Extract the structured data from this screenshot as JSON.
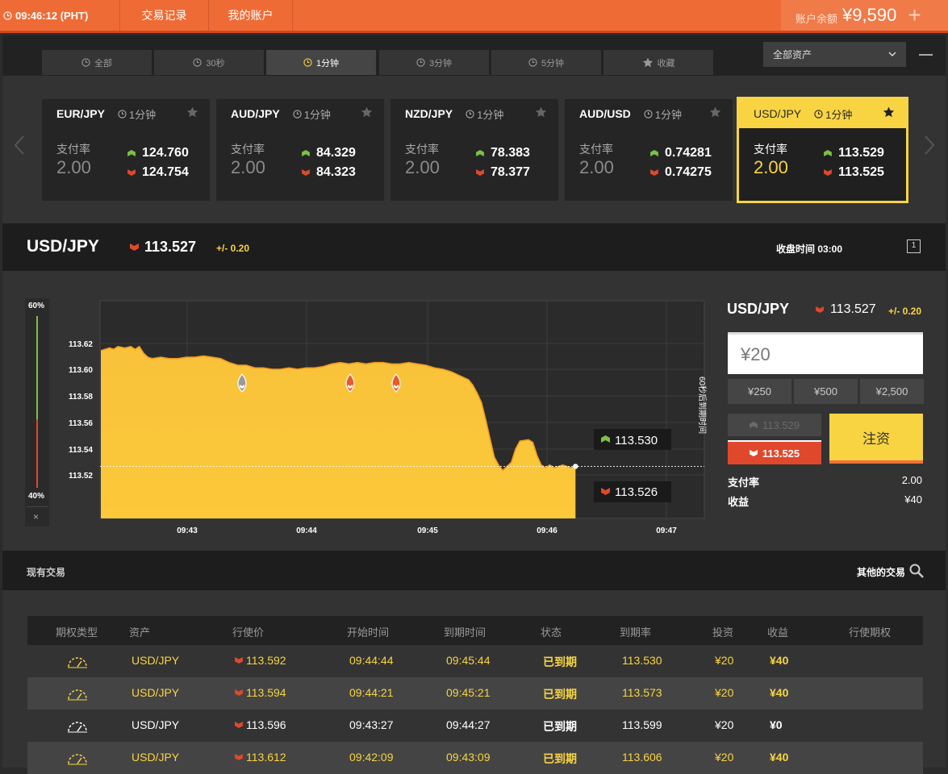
{
  "topbar": {
    "clock": "09:46:12 (PHT)",
    "nav_history": "交易记录",
    "nav_account": "我的账户",
    "balance_label": "账户余额",
    "balance_value": "¥9,590"
  },
  "filters": {
    "tabs": [
      {
        "label": "全部",
        "icon": "clock-icon"
      },
      {
        "label": "30秒",
        "icon": "clock-icon"
      },
      {
        "label": "1分钟",
        "icon": "clock-icon",
        "active": true
      },
      {
        "label": "3分钟",
        "icon": "clock-icon"
      },
      {
        "label": "5分钟",
        "icon": "clock-icon"
      },
      {
        "label": "收藏",
        "icon": "star-icon"
      }
    ],
    "asset_select": "全部资产"
  },
  "cards": [
    {
      "pair": "EUR/JPY",
      "timeframe": "1分钟",
      "rate_label": "支付率",
      "rate": "2.00",
      "up": "124.760",
      "down": "124.754"
    },
    {
      "pair": "AUD/JPY",
      "timeframe": "1分钟",
      "rate_label": "支付率",
      "rate": "2.00",
      "up": "84.329",
      "down": "84.323"
    },
    {
      "pair": "NZD/JPY",
      "timeframe": "1分钟",
      "rate_label": "支付率",
      "rate": "2.00",
      "up": "78.383",
      "down": "78.377"
    },
    {
      "pair": "AUD/USD",
      "timeframe": "1分钟",
      "rate_label": "支付率",
      "rate": "2.00",
      "up": "0.74281",
      "down": "0.74275"
    },
    {
      "pair": "USD/JPY",
      "timeframe": "1分钟",
      "rate_label": "支付率",
      "rate": "2.00",
      "up": "113.529",
      "down": "113.525",
      "selected": true
    }
  ],
  "pair_header": {
    "pair": "USD/JPY",
    "price": "113.527",
    "change": "+/- 0.20",
    "close_label": "收盘时间 03:00"
  },
  "sentiment": {
    "top": "60%",
    "bottom": "40%",
    "close": "×"
  },
  "chart_data": {
    "type": "area",
    "y_ticks": [
      "113.62",
      "113.60",
      "113.58",
      "113.56",
      "113.54",
      "113.52"
    ],
    "x_ticks": [
      "09:43",
      "09:44",
      "09:45",
      "09:46",
      "09:47"
    ],
    "expiry_text": "60秒后到期时间",
    "current_line": 113.527,
    "up_label": "113.530",
    "down_label": "113.526",
    "series": [
      {
        "points": [
          [
            0,
            113.614
          ],
          [
            0.05,
            113.615
          ],
          [
            0.1,
            113.616
          ],
          [
            0.15,
            113.615
          ],
          [
            0.2,
            113.617
          ],
          [
            0.28,
            113.616
          ],
          [
            0.35,
            113.617
          ],
          [
            0.4,
            113.615
          ],
          [
            0.45,
            113.617
          ],
          [
            0.5,
            113.612
          ],
          [
            0.55,
            113.609
          ],
          [
            0.6,
            113.608
          ],
          [
            0.7,
            113.609
          ],
          [
            0.8,
            113.608
          ],
          [
            0.9,
            113.608
          ],
          [
            1.0,
            113.609
          ],
          [
            1.1,
            113.609
          ],
          [
            1.2,
            113.61
          ],
          [
            1.3,
            113.609
          ],
          [
            1.4,
            113.608
          ],
          [
            1.5,
            113.605
          ],
          [
            1.6,
            113.603
          ],
          [
            1.7,
            113.603
          ],
          [
            1.8,
            113.601
          ],
          [
            1.9,
            113.601
          ],
          [
            2.0,
            113.6
          ],
          [
            2.1,
            113.6
          ],
          [
            2.2,
            113.601
          ],
          [
            2.3,
            113.6
          ],
          [
            2.4,
            113.601
          ],
          [
            2.5,
            113.601
          ],
          [
            2.6,
            113.602
          ],
          [
            2.7,
            113.604
          ],
          [
            2.8,
            113.605
          ],
          [
            2.9,
            113.604
          ],
          [
            3.0,
            113.605
          ],
          [
            3.1,
            113.604
          ],
          [
            3.2,
            113.605
          ],
          [
            3.3,
            113.605
          ],
          [
            3.4,
            113.604
          ],
          [
            3.5,
            113.604
          ],
          [
            3.6,
            113.605
          ],
          [
            3.7,
            113.604
          ],
          [
            3.8,
            113.603
          ],
          [
            3.9,
            113.601
          ],
          [
            4.0,
            113.6
          ],
          [
            4.1,
            113.598
          ],
          [
            4.2,
            113.595
          ],
          [
            4.3,
            113.592
          ],
          [
            4.35,
            113.588
          ],
          [
            4.4,
            113.582
          ],
          [
            4.45,
            113.575
          ],
          [
            4.5,
            113.562
          ],
          [
            4.55,
            113.548
          ],
          [
            4.6,
            113.534
          ],
          [
            4.65,
            113.528
          ],
          [
            4.7,
            113.524
          ],
          [
            4.8,
            113.53
          ],
          [
            4.85,
            113.54
          ],
          [
            4.9,
            113.546
          ],
          [
            5.0,
            113.547
          ],
          [
            5.05,
            113.545
          ],
          [
            5.1,
            113.535
          ],
          [
            5.15,
            113.528
          ],
          [
            5.2,
            113.526
          ],
          [
            5.25,
            113.528
          ],
          [
            5.3,
            113.526
          ],
          [
            5.4,
            113.528
          ],
          [
            5.5,
            113.526
          ],
          [
            5.55,
            113.527
          ]
        ]
      }
    ]
  },
  "order_panel": {
    "pair": "USD/JPY",
    "price": "113.527",
    "change": "+/- 0.20",
    "amount": "¥20",
    "quick_amounts": [
      "¥250",
      "¥500",
      "¥2,500"
    ],
    "up_price": "113.529",
    "down_price": "113.525",
    "invest_button": "注资",
    "payout_label": "支付率",
    "payout_value": "2.00",
    "profit_label": "收益",
    "profit_value": "¥40"
  },
  "trades_bar": {
    "title": "现有交易",
    "other_label": "其他的交易"
  },
  "table": {
    "headers": [
      "期权类型",
      "资产",
      "行使价",
      "开始时间",
      "到期时间",
      "状态",
      "到期率",
      "投资",
      "收益",
      "行使期权"
    ],
    "rows": [
      {
        "asset": "USD/JPY",
        "strike": "113.592",
        "start": "09:44:44",
        "expiry": "09:45:44",
        "status": "已到期",
        "rate": "113.530",
        "invest": "¥20",
        "profit": "¥40",
        "highlight": true
      },
      {
        "asset": "USD/JPY",
        "strike": "113.594",
        "start": "09:44:21",
        "expiry": "09:45:21",
        "status": "已到期",
        "rate": "113.573",
        "invest": "¥20",
        "profit": "¥40",
        "highlight": true
      },
      {
        "asset": "USD/JPY",
        "strike": "113.596",
        "start": "09:43:27",
        "expiry": "09:44:27",
        "status": "已到期",
        "rate": "113.599",
        "invest": "¥20",
        "profit": "¥0",
        "highlight": false
      },
      {
        "asset": "USD/JPY",
        "strike": "113.612",
        "start": "09:42:09",
        "expiry": "09:43:09",
        "status": "已到期",
        "rate": "113.606",
        "invest": "¥20",
        "profit": "¥40",
        "highlight": true
      }
    ]
  },
  "colors": {
    "orange": "#ef6b35",
    "yellow": "#f8d443",
    "up": "#7bc143",
    "down": "#e0482c"
  }
}
